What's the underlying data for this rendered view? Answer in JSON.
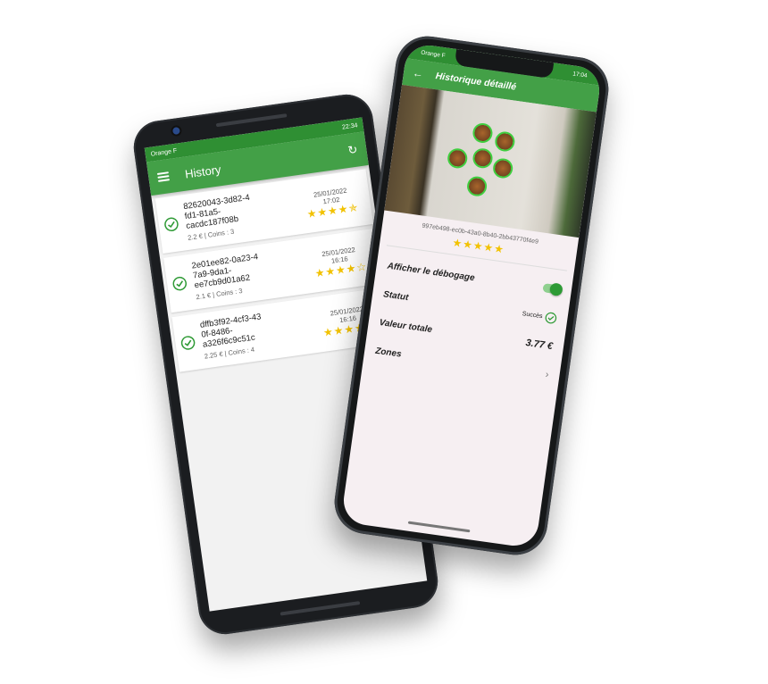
{
  "phone1": {
    "status": {
      "carrier": "Orange F",
      "time": "22:34"
    },
    "appbar": {
      "title": "History",
      "menu_icon": "hamburger-icon",
      "refresh_icon": "refresh-icon"
    },
    "items": [
      {
        "id": "82620043-3d82-4\nfd1-81a5-\ncacdc187f08b",
        "meta": "2.2 € | Coins : 3",
        "date": "25/01/2022",
        "time": "17:02",
        "stars": "★★★★✯"
      },
      {
        "id": "2e01ee82-0a23-4\n7a9-9da1-\nee7cb9d01a62",
        "meta": "2.1 € | Coins : 3",
        "date": "25/01/2022",
        "time": "16:16",
        "stars": "★★★★☆"
      },
      {
        "id": "dffb3f92-4cf3-43\n0f-8486-\na326f6c9c51c",
        "meta": "2.25 € | Coins : 4",
        "date": "25/01/2022",
        "time": "16:16",
        "stars": "★★★★☆"
      }
    ]
  },
  "phone2": {
    "status": {
      "carrier": "Orange F",
      "time": "17:04"
    },
    "appbar": {
      "title": "Historique détaillé",
      "back_icon": "arrow-left-icon"
    },
    "hash": "997eb498-ec0b-43a0-8b40-2bb43770f4e9",
    "stars": "★★★★★",
    "debug": {
      "label": "Afficher le débogage",
      "on": true
    },
    "status_row": {
      "label": "Statut",
      "value": "Succès"
    },
    "total_row": {
      "label": "Valeur totale",
      "value": "3.77 €"
    },
    "zones_row": {
      "label": "Zones"
    }
  },
  "colors": {
    "primary": "#43a047",
    "primary_dark": "#2f8f33",
    "star": "#f2c200"
  }
}
